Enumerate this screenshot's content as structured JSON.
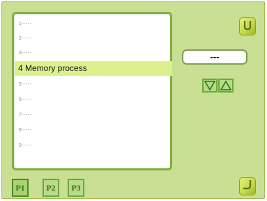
{
  "list": {
    "items": [
      {
        "label": "1-----"
      },
      {
        "label": "2-----"
      },
      {
        "label": "3-----"
      },
      {
        "label": "4 Memory process",
        "selected": true
      },
      {
        "label": "5-----"
      },
      {
        "label": "6-----"
      },
      {
        "label": "7-----"
      },
      {
        "label": "8-----"
      },
      {
        "label": "9-----"
      }
    ]
  },
  "value_field": {
    "value": "---"
  },
  "page_tabs": [
    {
      "label": "P1",
      "active": true
    },
    {
      "label": "P2"
    },
    {
      "label": "P3"
    }
  ],
  "icons": {
    "top_right": "return-icon",
    "bottom_right": "enter-icon",
    "down": "triangle-down-icon",
    "up": "triangle-up-icon"
  },
  "colors": {
    "screen_bg": "#c9df93",
    "panel_border": "#7eb03f",
    "highlight": "#dcf08e"
  }
}
